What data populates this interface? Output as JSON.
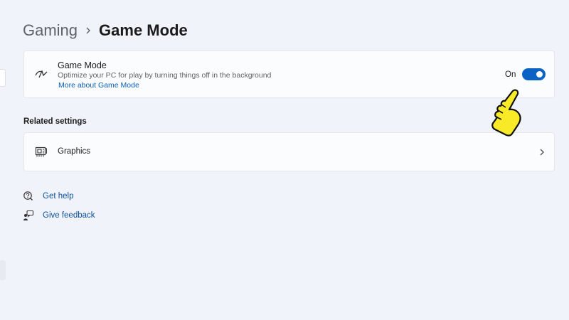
{
  "breadcrumb": {
    "parent": "Gaming",
    "current": "Game Mode"
  },
  "game_mode": {
    "title": "Game Mode",
    "description": "Optimize your PC for play by turning things off in the background",
    "link": "More about Game Mode",
    "toggle_state": "On",
    "toggle_on": true,
    "icon": "game-mode-icon"
  },
  "related": {
    "heading": "Related settings",
    "items": [
      {
        "label": "Graphics",
        "icon": "graphics-card-icon"
      }
    ]
  },
  "help_links": [
    {
      "label": "Get help",
      "icon": "help-icon"
    },
    {
      "label": "Give feedback",
      "icon": "feedback-icon"
    }
  ],
  "colors": {
    "accent": "#0b62c4",
    "link": "#0a5fb4",
    "background": "#f0f3f9",
    "card": "#fbfcfe"
  }
}
